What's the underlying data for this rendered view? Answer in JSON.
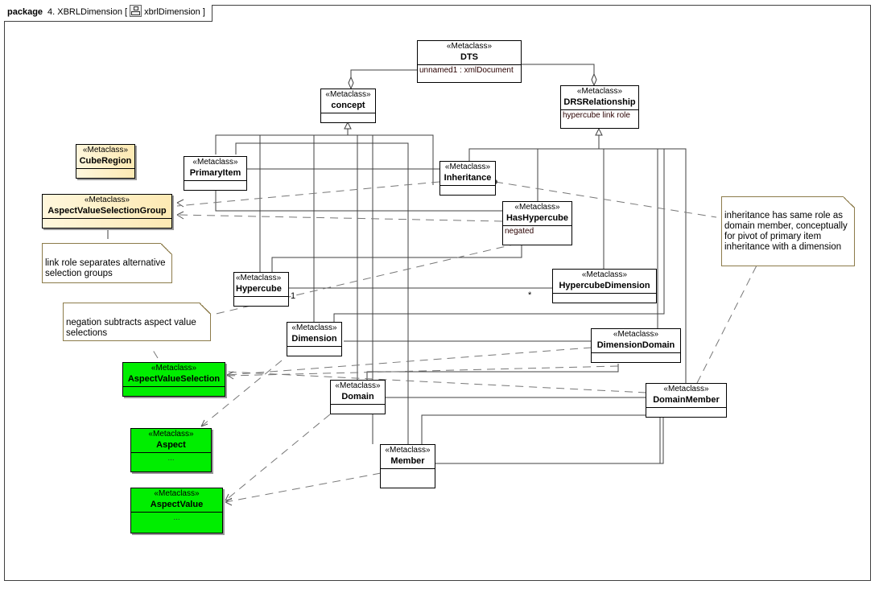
{
  "package": {
    "keyword": "package",
    "name": "4. XBRLDimension [",
    "diagram_icon": "class-diagram-icon",
    "diagram_name": "xbrlDimension ]"
  },
  "stereotype": "«Metaclass»",
  "classes": {
    "dts": {
      "name": "DTS",
      "attribute": "unnamed1 : xmlDocument"
    },
    "concept": {
      "name": "concept"
    },
    "drs": {
      "name": "DRSRelationship",
      "attribute": "hypercube link role"
    },
    "cuberegion": {
      "name": "CubeRegion"
    },
    "avsg": {
      "name": "AspectValueSelectionGroup"
    },
    "primaryitem": {
      "name": "PrimaryItem"
    },
    "inheritance": {
      "name": "Inheritance"
    },
    "hashypercube": {
      "name": "HasHypercube",
      "attribute": "negated"
    },
    "hypercube": {
      "name": "Hypercube"
    },
    "hypercubedimension": {
      "name": "HypercubeDimension"
    },
    "dimension": {
      "name": "Dimension"
    },
    "dimensiondomain": {
      "name": "DimensionDomain"
    },
    "avs": {
      "name": "AspectValueSelection"
    },
    "domain": {
      "name": "Domain"
    },
    "domainmember": {
      "name": "DomainMember"
    },
    "member": {
      "name": "Member"
    },
    "aspect": {
      "name": "Aspect",
      "attribute": "..."
    },
    "aspectvalue": {
      "name": "AspectValue",
      "attribute": "..."
    }
  },
  "notes": {
    "linkrole": "link role separates alternative selection groups",
    "negation": "negation subtracts aspect value selections",
    "inheritance": "inheritance has same role as domain member, conceptually for pivot of primary item inheritance with a dimension"
  },
  "multiplicities": {
    "hypercube_end": "1",
    "hypercubedimension_end": "*"
  },
  "colors": {
    "yellow_class": "#fde9b3",
    "green_class": "#00ee00",
    "note_border": "#8c7b4a",
    "line": "#404040"
  }
}
